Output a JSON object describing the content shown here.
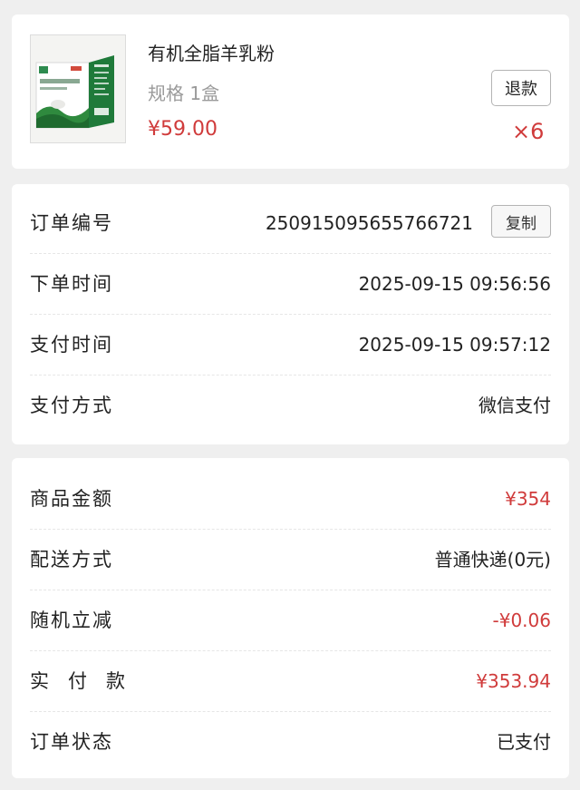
{
  "product": {
    "title": "有机全脂羊乳粉",
    "spec": "规格 1盒",
    "price": "¥59.00",
    "quantity": "×6",
    "refund_label": "退款",
    "thumbnail_icon": "milk-powder-box-image",
    "accent_green": "#1f7a3a"
  },
  "order": {
    "number_label": "订单编号",
    "number": "250915095655766721",
    "copy_label": "复制",
    "order_time_label": "下单时间",
    "order_time": "2025-09-15 09:56:56",
    "pay_time_label": "支付时间",
    "pay_time": "2025-09-15 09:57:12",
    "pay_method_label": "支付方式",
    "pay_method": "微信支付"
  },
  "amounts": {
    "goods_label": "商品金额",
    "goods": "¥354",
    "delivery_label": "配送方式",
    "delivery": "普通快递(0元)",
    "discount_label": "随机立减",
    "discount": "-¥0.06",
    "paid_label": "实付款",
    "paid": "¥353.94",
    "status_label": "订单状态",
    "status": "已支付"
  },
  "colors": {
    "price_red": "#d03b3b",
    "background": "#efefef"
  }
}
